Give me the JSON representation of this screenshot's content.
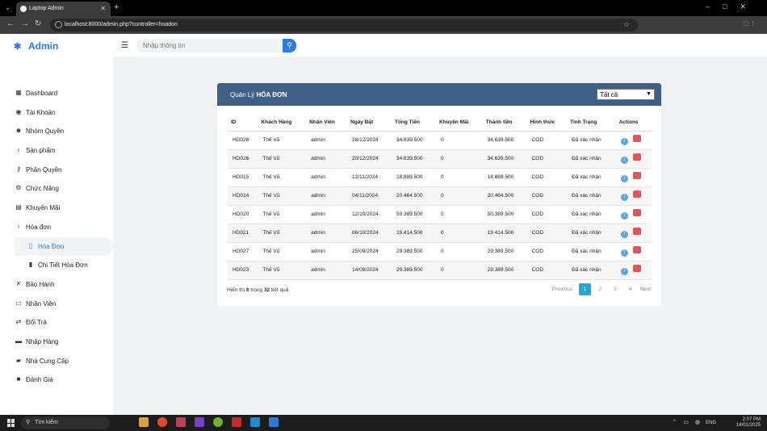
{
  "browser": {
    "tab_title": "Laptop Admin",
    "url": "localhost:8000/admin.php?controller=hoadon"
  },
  "brand": "Admin",
  "search": {
    "placeholder": "Nhập thông tin"
  },
  "menu": [
    {
      "label": "Dashboard",
      "icon": "table-icon"
    },
    {
      "label": "Tài Khoản",
      "icon": "user-circle-icon"
    },
    {
      "label": "Nhóm Quyền",
      "icon": "users-icon"
    },
    {
      "label": "Sản phẩm",
      "icon": "chevron-right-icon"
    },
    {
      "label": "Phân Quyền",
      "icon": "key-icon"
    },
    {
      "label": "Chức Năng",
      "icon": "gears-icon"
    },
    {
      "label": "Khuyến Mãi",
      "icon": "shopping-cart-icon"
    },
    {
      "label": "Hóa đơn",
      "icon": "chevron-right-icon"
    },
    {
      "label": "Hóa Đơn",
      "icon": "file-icon"
    },
    {
      "label": "Chi Tiết Hóa Đơn",
      "icon": "clipboard-icon"
    },
    {
      "label": "Bảo Hành",
      "icon": "tools-icon"
    },
    {
      "label": "Nhân Viên",
      "icon": "id-card-icon"
    },
    {
      "label": "Đổi Trả",
      "icon": "exchange-icon"
    },
    {
      "label": "Nhập Hàng",
      "icon": "inbox-icon"
    },
    {
      "label": "Nhà Cung Cấp",
      "icon": "truck-icon"
    },
    {
      "label": "Đánh Giá",
      "icon": "comment-icon"
    }
  ],
  "card": {
    "title_prefix": "Quản Lý",
    "title_strong": "HÓA ĐƠN",
    "filter_value": "Tất cả"
  },
  "table": {
    "headers": [
      "ID",
      "Khách Hàng",
      "Nhân Viên",
      "Ngày Đặt",
      "Tổng Tiền",
      "Khuyến Mãi",
      "Thành tiền",
      "Hình thức",
      "Tình Trạng",
      "Actions"
    ],
    "rows": [
      [
        "HD028",
        "Thế Vũ",
        "admin",
        "28/12/2024",
        "34.639.500",
        "0",
        "34.639.500",
        "COD",
        "Đã xác nhận"
      ],
      [
        "HD026",
        "Thế Vũ",
        "admin",
        "20/12/2024",
        "34.639.500",
        "0",
        "34.639.500",
        "COD",
        "Đã xác nhận"
      ],
      [
        "HD015",
        "Thế Vũ",
        "admin",
        "12/11/2024",
        "18.889.500",
        "0",
        "18.889.500",
        "COD",
        "Đã xác nhận"
      ],
      [
        "HD014",
        "Thế Vũ",
        "admin",
        "04/11/2024",
        "20.464.500",
        "0",
        "20.464.500",
        "COD",
        "Đã xác nhận"
      ],
      [
        "HD020",
        "Thế Vũ",
        "admin",
        "12/10/2024",
        "50.389.500",
        "0",
        "50.389.500",
        "COD",
        "Đã xác nhận"
      ],
      [
        "HD021",
        "Thế Vũ",
        "admin",
        "06/10/2024",
        "19.414.500",
        "0",
        "19.414.500",
        "COD",
        "Đã xác nhận"
      ],
      [
        "HD027",
        "Thế Vũ",
        "admin",
        "25/09/2024",
        "29.389.500",
        "0",
        "29.389.500",
        "COD",
        "Đã xác nhận"
      ],
      [
        "HD023",
        "Thế Vũ",
        "admin",
        "14/09/2024",
        "29.389.500",
        "0",
        "29.389.500",
        "COD",
        "Đã xác nhận"
      ]
    ]
  },
  "footer": {
    "prefix": "Hiển thị",
    "shown": "8",
    "mid": "trong",
    "total": "32",
    "suffix": "kết quả"
  },
  "pager": {
    "prev": "Previous",
    "pages": [
      "1",
      "2",
      "3",
      "4"
    ],
    "next": "Next"
  },
  "taskbar": {
    "search": "Tìm kiếm",
    "lang": "ENG",
    "time": "2:07 PM",
    "date": "14/01/2025"
  },
  "colors": {
    "header": "#3f5f88",
    "accent": "#2c7be5",
    "page_active": "#25a6d9",
    "delete": "#e0555a"
  }
}
